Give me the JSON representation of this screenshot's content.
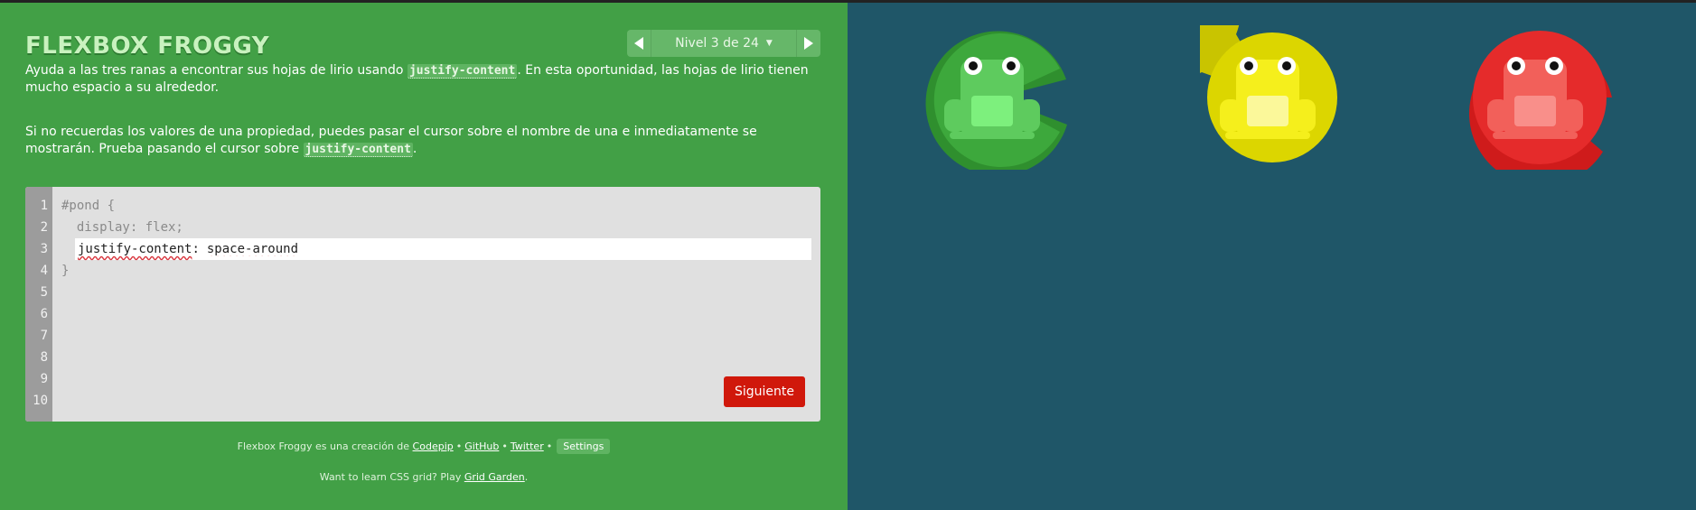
{
  "header": {
    "logo": "FLEXBOX FROGGY",
    "level_label": "Nivel 3 de 24",
    "prev_icon": "arrow-left-icon",
    "next_icon": "arrow-right-icon",
    "caret_icon": "caret-down-icon"
  },
  "instructions": {
    "p1_before": "Ayuda a las tres ranas a encontrar sus hojas de lirio usando ",
    "p1_code": "justify-content",
    "p1_after": ". En esta oportunidad, las hojas de lirio tienen mucho espacio a su alrededor.",
    "p2_before": "Si no recuerdas los valores de una propiedad, puedes pasar el cursor sobre el nombre de una e inmediatamente se mostrarán. Prueba pasando el cursor sobre ",
    "p2_code": "justify-content",
    "p2_after": "."
  },
  "editor": {
    "line_numbers": [
      "1",
      "2",
      "3",
      "4",
      "5",
      "6",
      "7",
      "8",
      "9",
      "10"
    ],
    "line1": "#pond {",
    "line2": "  display: flex;",
    "property": "justify-content",
    "colon": ":",
    "value": "space-around",
    "line4": "}",
    "next_button": "Siguiente"
  },
  "footer": {
    "credit_text": "Flexbox Froggy es una creación de ",
    "codepip": "Codepip",
    "github": "GitHub",
    "twitter": "Twitter",
    "bullet": "•",
    "settings": "Settings",
    "grid_text": "Want to learn CSS grid? Play ",
    "grid_link": "Grid Garden",
    "grid_end": "."
  },
  "pond": {
    "frogs": [
      {
        "color": "green",
        "frog": "#5ecb5e",
        "pad": "#2f8f2e",
        "pad_light": "#3da83c"
      },
      {
        "color": "yellow",
        "frog": "#f5ef1c",
        "pad": "#c9c400",
        "pad_light": "#dcd600"
      },
      {
        "color": "red",
        "frog": "#f2605a",
        "pad": "#cf1b1b",
        "pad_light": "#e52b2b"
      }
    ]
  },
  "colors": {
    "sidebar_bg": "#42a046",
    "pond_bg": "#1f5668",
    "button_red": "#d0180b"
  }
}
